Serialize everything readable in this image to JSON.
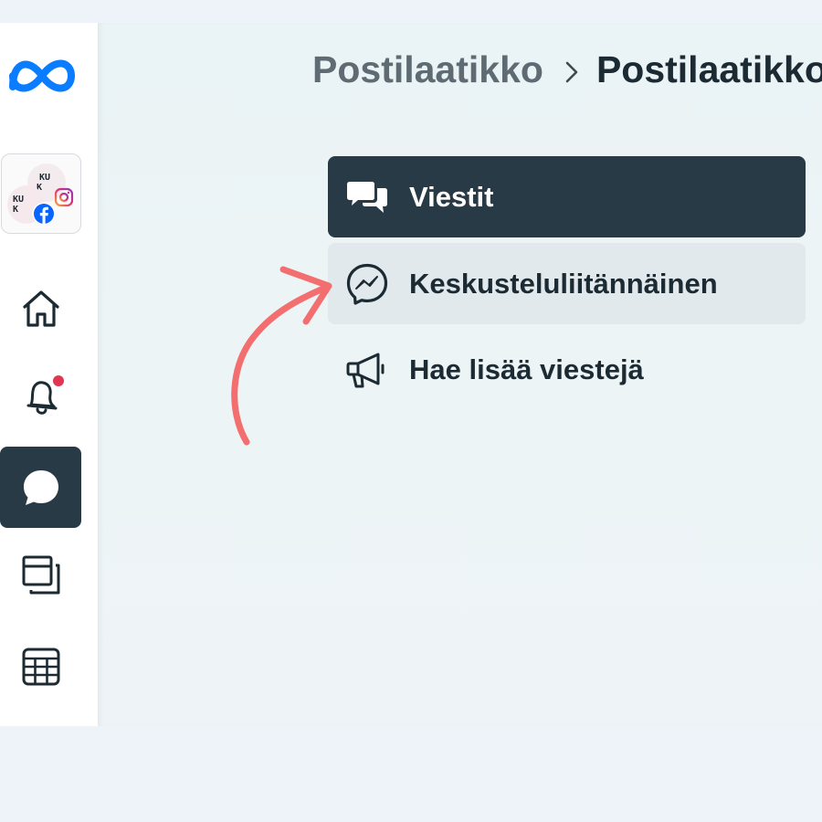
{
  "colors": {
    "sidebar_bg": "#ffffff",
    "active_bg": "#283a45",
    "hover_bg": "#e1e9ec",
    "text_dark": "#1c2b33",
    "text_muted": "#5f6b73",
    "notification_dot": "#e0364f",
    "annotation_arrow": "#f36f6f",
    "meta_blue": "#0a7cff"
  },
  "sidebar": {
    "logo": "meta-logo",
    "account": {
      "initials_back": [
        "KU",
        "K"
      ],
      "initials_front": [
        "KU",
        "K"
      ],
      "badges": [
        "instagram-icon",
        "facebook-icon"
      ]
    },
    "items": [
      {
        "id": "home",
        "icon": "home-icon",
        "active": false
      },
      {
        "id": "notifications",
        "icon": "bell-icon",
        "active": false,
        "has_badge": true
      },
      {
        "id": "inbox",
        "icon": "chat-bubble-icon",
        "active": true
      },
      {
        "id": "content",
        "icon": "stacked-pages-icon",
        "active": false
      },
      {
        "id": "planner",
        "icon": "table-icon",
        "active": false
      }
    ]
  },
  "breadcrumb": {
    "parent": "Postilaatikko",
    "separator_icon": "chevron-right-icon",
    "current": "Postilaatikko"
  },
  "menu": {
    "items": [
      {
        "label": "Viestit",
        "icon": "messages-icon",
        "state": "active"
      },
      {
        "label": "Keskusteluliitännäinen",
        "icon": "messenger-icon",
        "state": "hover"
      },
      {
        "label": "Hae lisää viestejä",
        "icon": "megaphone-icon",
        "state": "default"
      }
    ]
  },
  "annotation": {
    "icon": "curved-arrow-icon"
  }
}
